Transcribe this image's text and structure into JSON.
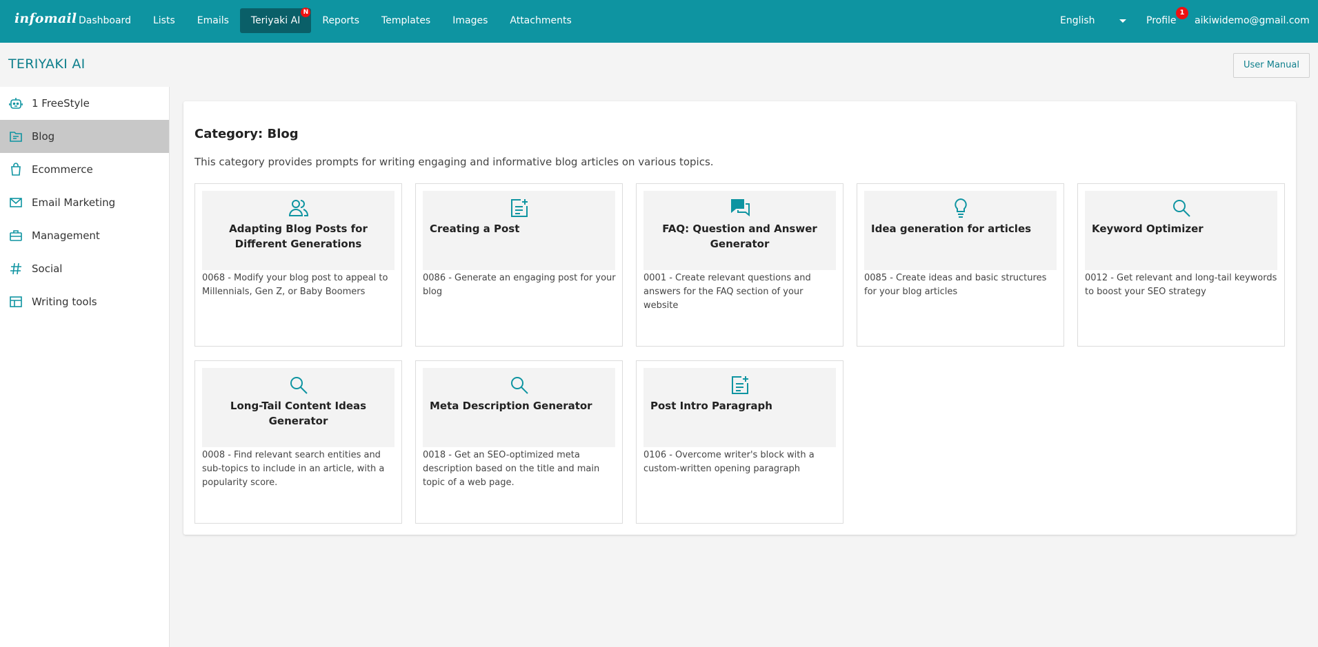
{
  "brand": "infomail",
  "nav": [
    {
      "label": "Dashboard"
    },
    {
      "label": "Lists"
    },
    {
      "label": "Emails"
    },
    {
      "label": "Teriyaki AI",
      "badge": "N",
      "active": true
    },
    {
      "label": "Reports"
    },
    {
      "label": "Templates"
    },
    {
      "label": "Images"
    },
    {
      "label": "Attachments"
    }
  ],
  "language": "English",
  "profile": {
    "label": "Profile",
    "badge": "1"
  },
  "user_email": "aikiwidemo@gmail.com",
  "page": {
    "title": "TERIYAKI AI",
    "manual_button": "User Manual"
  },
  "sidebar": {
    "items": [
      {
        "label": "1 FreeStyle",
        "icon": "robot-icon"
      },
      {
        "label": "Blog",
        "icon": "folder-icon",
        "active": true
      },
      {
        "label": "Ecommerce",
        "icon": "shopping-bag-icon"
      },
      {
        "label": "Email Marketing",
        "icon": "envelope-icon"
      },
      {
        "label": "Management",
        "icon": "briefcase-icon"
      },
      {
        "label": "Social",
        "icon": "hashtag-icon"
      },
      {
        "label": "Writing tools",
        "icon": "layout-icon"
      }
    ]
  },
  "category": {
    "title": "Category: Blog",
    "description": "This category provides prompts for writing engaging and informative blog articles on various topics."
  },
  "prompts": [
    {
      "title": "Adapting Blog Posts for Different Generations",
      "desc": "0068 - Modify your blog post to appeal to Millennials, Gen Z, or Baby Boomers",
      "icon": "people-icon"
    },
    {
      "title": "Creating a Post",
      "desc": "0086 - Generate an engaging post for your blog",
      "icon": "document-add-icon"
    },
    {
      "title": "FAQ: Question and Answer Generator",
      "desc": "0001 - Create relevant questions and answers for the FAQ section of your website",
      "icon": "chat-icon"
    },
    {
      "title": "Idea generation for articles",
      "desc": "0085 - Create ideas and basic structures for your blog articles",
      "icon": "lightbulb-icon"
    },
    {
      "title": "Keyword Optimizer",
      "desc": "0012 - Get relevant and long-tail keywords to boost your SEO strategy",
      "icon": "search-icon"
    },
    {
      "title": "Long-Tail Content Ideas Generator",
      "desc": "0008 - Find relevant search entities and sub-topics to include in an article, with a popularity score.",
      "icon": "search-icon"
    },
    {
      "title": "Meta Description Generator",
      "desc": "0018 - Get an SEO-optimized meta description based on the title and main topic of a web page.",
      "icon": "search-icon"
    },
    {
      "title": "Post Intro Paragraph",
      "desc": "0106 - Overcome writer's block with a custom-written opening paragraph",
      "icon": "document-add-icon"
    }
  ],
  "colors": {
    "primary": "#0e94a1",
    "accent_text": "#0e7f8c",
    "badge": "#ee1111"
  }
}
